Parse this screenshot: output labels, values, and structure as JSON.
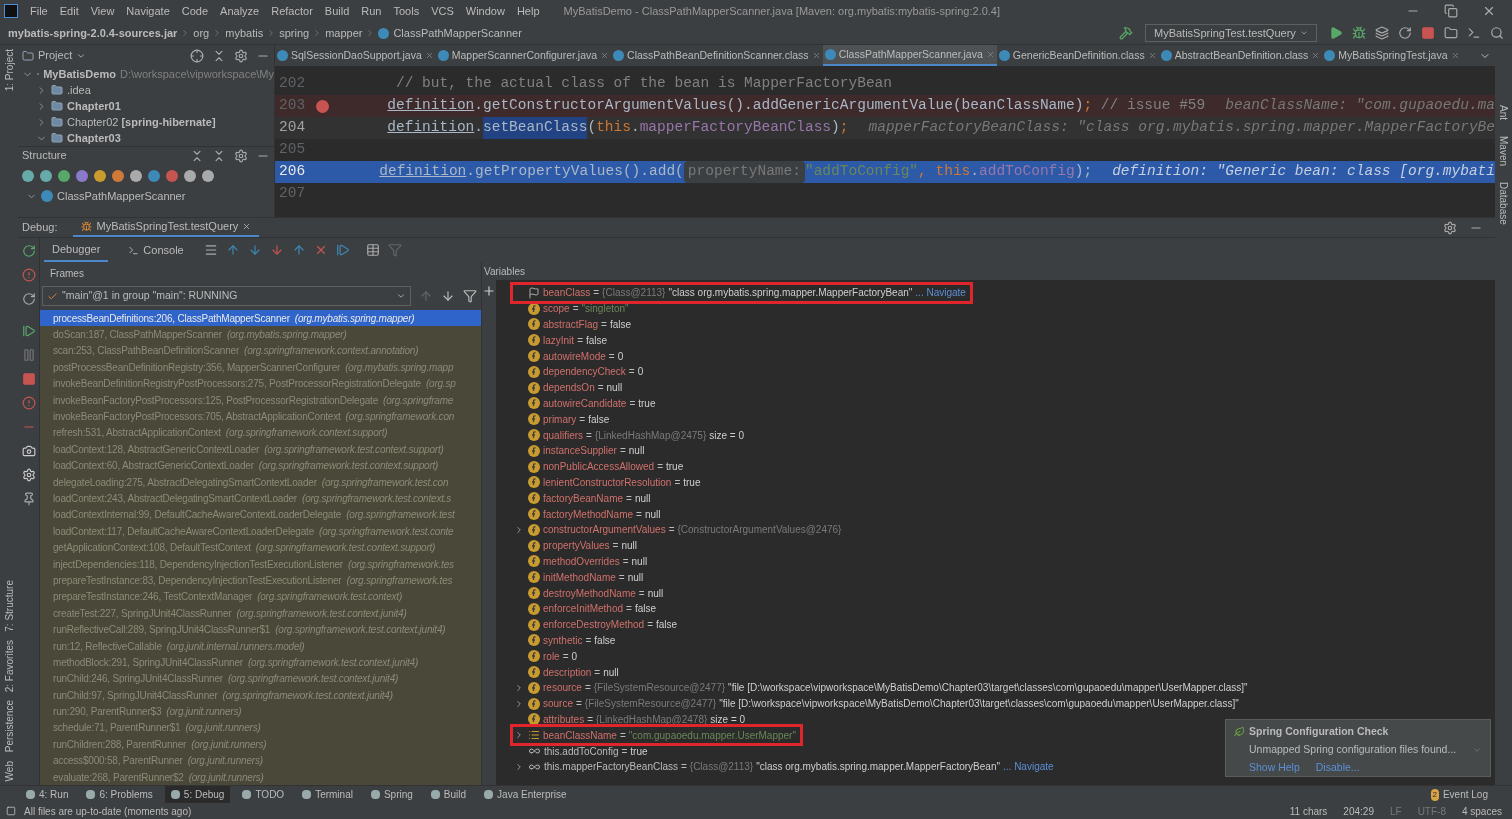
{
  "menu": [
    "File",
    "Edit",
    "View",
    "Navigate",
    "Code",
    "Analyze",
    "Refactor",
    "Build",
    "Run",
    "Tools",
    "VCS",
    "Window",
    "Help"
  ],
  "window": {
    "title": "MyBatisDemo - ClassPathMapperScanner.java [Maven: org.mybatis:mybatis-spring:2.0.4]"
  },
  "breadcrumb": [
    "mybatis-spring-2.0.4-sources.jar",
    "org",
    "mybatis",
    "spring",
    "mapper",
    "ClassPathMapperScanner"
  ],
  "run_config": "MyBatisSpringTest.testQuery",
  "left_strip": [
    "1: Project",
    "7: Structure",
    "2: Favorites",
    "Persistence",
    "Web"
  ],
  "right_strip": [
    "Ant",
    "Maven",
    "Database"
  ],
  "project": {
    "title": "Project",
    "tree": [
      {
        "label": "MyBatisDemo",
        "path": "D:\\workspace\\vipworkspace\\My",
        "bold": true,
        "expanded": true,
        "children": [
          {
            "label": ".idea",
            "bold": false,
            "expanded": false
          },
          {
            "label": "Chapter01",
            "bold": true,
            "expanded": false
          },
          {
            "label": "Chapter02 **[spring-hibernate]**",
            "bold": false,
            "expanded": false
          },
          {
            "label": "Chapter03",
            "bold": true,
            "expanded": true
          }
        ]
      }
    ]
  },
  "structure": {
    "title": "Structure",
    "root": "ClassPathMapperScanner"
  },
  "editor_tabs": [
    {
      "label": "SqlSessionDaoSupport.java",
      "selected": false
    },
    {
      "label": "MapperScannerConfigurer.java",
      "selected": false
    },
    {
      "label": "ClassPathBeanDefinitionScanner.class",
      "selected": false
    },
    {
      "label": "ClassPathMapperScanner.java",
      "selected": true
    },
    {
      "label": "GenericBeanDefinition.class",
      "selected": false
    },
    {
      "label": "AbstractBeanDefinition.class",
      "selected": false
    },
    {
      "label": "MyBatisSpringTest.java",
      "selected": false
    }
  ],
  "code": [
    {
      "number": "202",
      "kind": "plain",
      "segments": [
        {
          "text": "// but, the actual class of the bean is MapperFactoryBean",
          "kind": "comment"
        }
      ]
    },
    {
      "number": "203",
      "kind": "breakpoint",
      "segments": [
        {
          "text": "definition",
          "kind": "var"
        },
        {
          "text": ".getConstructorArgumentValues().addGenericArgumentValue(beanClassName)",
          "kind": "plain"
        },
        {
          "text": ";",
          "kind": "keyword"
        },
        {
          "text": " // issue #59",
          "kind": "comment"
        }
      ],
      "hint": "beanClassName: \"com.gupaoedu.ma"
    },
    {
      "number": "204",
      "kind": "caret",
      "segments": [
        {
          "text": "definition",
          "kind": "var"
        },
        {
          "text": ".",
          "kind": "plain"
        },
        {
          "text": "setBeanClass",
          "kind": "selection"
        },
        {
          "text": "(",
          "kind": "plain"
        },
        {
          "text": "this",
          "kind": "keyword"
        },
        {
          "text": ".",
          "kind": "plain"
        },
        {
          "text": "mapperFactoryBeanClass",
          "kind": "field"
        },
        {
          "text": ")",
          "kind": "plain"
        },
        {
          "text": ";",
          "kind": "keyword"
        }
      ],
      "hint": "mapperFactoryBeanClass: \"class org.mybatis.spring.mapper.MapperFactoryBe"
    },
    {
      "number": "205",
      "kind": "plain"
    },
    {
      "number": "206",
      "kind": "execution",
      "segments": [
        {
          "text": "definition",
          "kind": "var"
        },
        {
          "text": ".getPropertyValues().add(",
          "kind": "plain"
        },
        {
          "text": "propertyName:",
          "kind": "param"
        },
        {
          "text": "\"addToConfig\"",
          "kind": "string"
        },
        {
          "text": ", ",
          "kind": "keyword"
        },
        {
          "text": "this",
          "kind": "keyword"
        },
        {
          "text": ".",
          "kind": "plain"
        },
        {
          "text": "addToConfig",
          "kind": "field"
        },
        {
          "text": ");",
          "kind": "plain"
        }
      ],
      "hint": "definition: \"Generic bean: class [org.mybati"
    },
    {
      "number": "207",
      "kind": "plain"
    }
  ],
  "debug": {
    "label": "Debug:",
    "session": "MyBatisSpringTest.testQuery",
    "tabs": [
      {
        "label": "Debugger",
        "selected": true
      },
      {
        "label": "Console",
        "selected": false
      }
    ],
    "frames_title": "Frames",
    "thread": "\"main\"@1 in group \"main\": RUNNING",
    "frames": [
      {
        "method": "processBeanDefinitions:206, ClassPathMapperScanner",
        "package": "(org.mybatis.spring.mapper)",
        "selected": true
      },
      {
        "method": "doScan:187, ClassPathMapperScanner",
        "package": "(org.mybatis.spring.mapper)",
        "selected": false
      },
      {
        "method": "scan:253, ClassPathBeanDefinitionScanner",
        "package": "(org.springframework.context.annotation)",
        "selected": false
      },
      {
        "method": "postProcessBeanDefinitionRegistry:356, MapperScannerConfigurer",
        "package": "(org.mybatis.spring.mapp",
        "selected": false
      },
      {
        "method": "invokeBeanDefinitionRegistryPostProcessors:275, PostProcessorRegistrationDelegate",
        "package": "(org.sp",
        "selected": false
      },
      {
        "method": "invokeBeanFactoryPostProcessors:125, PostProcessorRegistrationDelegate",
        "package": "(org.springframe",
        "selected": false
      },
      {
        "method": "invokeBeanFactoryPostProcessors:705, AbstractApplicationContext",
        "package": "(org.springframework.con",
        "selected": false
      },
      {
        "method": "refresh:531, AbstractApplicationContext",
        "package": "(org.springframework.context.support)",
        "selected": false
      },
      {
        "method": "loadContext:128, AbstractGenericContextLoader",
        "package": "(org.springframework.test.context.support)",
        "selected": false
      },
      {
        "method": "loadContext:60, AbstractGenericContextLoader",
        "package": "(org.springframework.test.context.support)",
        "selected": false
      },
      {
        "method": "delegateLoading:275, AbstractDelegatingSmartContextLoader",
        "package": "(org.springframework.test.con",
        "selected": false
      },
      {
        "method": "loadContext:243, AbstractDelegatingSmartContextLoader",
        "package": "(org.springframework.test.context.s",
        "selected": false
      },
      {
        "method": "loadContextInternal:99, DefaultCacheAwareContextLoaderDelegate",
        "package": "(org.springframework.test",
        "selected": false
      },
      {
        "method": "loadContext:117, DefaultCacheAwareContextLoaderDelegate",
        "package": "(org.springframework.test.conte",
        "selected": false
      },
      {
        "method": "getApplicationContext:108, DefaultTestContext",
        "package": "(org.springframework.test.context.support)",
        "selected": false
      },
      {
        "method": "injectDependencies:118, DependencyInjectionTestExecutionListener",
        "package": "(org.springframework.tes",
        "selected": false
      },
      {
        "method": "prepareTestInstance:83, DependencyInjectionTestExecutionListener",
        "package": "(org.springframework.tes",
        "selected": false
      },
      {
        "method": "prepareTestInstance:246, TestContextManager",
        "package": "(org.springframework.test.context)",
        "selected": false
      },
      {
        "method": "createTest:227, SpringJUnit4ClassRunner",
        "package": "(org.springframework.test.context.junit4)",
        "selected": false
      },
      {
        "method": "runReflectiveCall:289, SpringJUnit4ClassRunner$1",
        "package": "(org.springframework.test.context.junit4)",
        "selected": false
      },
      {
        "method": "run:12, ReflectiveCallable",
        "package": "(org.junit.internal.runners.model)",
        "selected": false
      },
      {
        "method": "methodBlock:291, SpringJUnit4ClassRunner",
        "package": "(org.springframework.test.context.junit4)",
        "selected": false
      },
      {
        "method": "runChild:246, SpringJUnit4ClassRunner",
        "package": "(org.springframework.test.context.junit4)",
        "selected": false
      },
      {
        "method": "runChild:97, SpringJUnit4ClassRunner",
        "package": "(org.springframework.test.context.junit4)",
        "selected": false
      },
      {
        "method": "run:290, ParentRunner$3",
        "package": "(org.junit.runners)",
        "selected": false
      },
      {
        "method": "schedule:71, ParentRunner$1",
        "package": "(org.junit.runners)",
        "selected": false
      },
      {
        "method": "runChildren:288, ParentRunner",
        "package": "(org.junit.runners)",
        "selected": false
      },
      {
        "method": "access$000:58, ParentRunner",
        "package": "(org.junit.runners)",
        "selected": false
      },
      {
        "method": "evaluate:268, ParentRunner$2",
        "package": "(org.junit.runners)",
        "selected": false
      }
    ],
    "variables_title": "Variables",
    "variables": [
      {
        "kind": "flag",
        "name": "beanClass",
        "sign": "=",
        "type": "{Class@2113}",
        "value": "\"class org.mybatis.spring.mapper.MapperFactoryBean\"",
        "link": "... Navigate",
        "expandable": false,
        "highlighted": true
      },
      {
        "kind": "field",
        "name": "scope",
        "sign": "=",
        "value": "\"singleton\"",
        "string": true,
        "expandable": false,
        "highlighted": false
      },
      {
        "kind": "field",
        "name": "abstractFlag",
        "sign": "=",
        "value": "false",
        "expandable": false,
        "highlighted": false
      },
      {
        "kind": "field",
        "name": "lazyInit",
        "sign": "=",
        "value": "false",
        "expandable": false,
        "highlighted": false
      },
      {
        "kind": "field",
        "name": "autowireMode",
        "sign": "=",
        "value": "0",
        "expandable": false,
        "highlighted": false
      },
      {
        "kind": "field",
        "name": "dependencyCheck",
        "sign": "=",
        "value": "0",
        "expandable": false,
        "highlighted": false
      },
      {
        "kind": "field",
        "name": "dependsOn",
        "sign": "=",
        "value": "null",
        "expandable": false,
        "highlighted": false
      },
      {
        "kind": "field",
        "name": "autowireCandidate",
        "sign": "=",
        "value": "true",
        "expandable": false,
        "highlighted": false
      },
      {
        "kind": "field",
        "name": "primary",
        "sign": "=",
        "value": "false",
        "expandable": false,
        "highlighted": false
      },
      {
        "kind": "field",
        "name": "qualifiers",
        "sign": "=",
        "type": "{LinkedHashMap@2475}",
        "value": "size = 0",
        "expandable": false,
        "highlighted": false
      },
      {
        "kind": "field",
        "name": "instanceSupplier",
        "sign": "=",
        "value": "null",
        "expandable": false,
        "highlighted": false
      },
      {
        "kind": "field",
        "name": "nonPublicAccessAllowed",
        "sign": "=",
        "value": "true",
        "expandable": false,
        "highlighted": false
      },
      {
        "kind": "field",
        "name": "lenientConstructorResolution",
        "sign": "=",
        "value": "true",
        "expandable": false,
        "highlighted": false
      },
      {
        "kind": "field",
        "name": "factoryBeanName",
        "sign": "=",
        "value": "null",
        "expandable": false,
        "highlighted": false
      },
      {
        "kind": "field",
        "name": "factoryMethodName",
        "sign": "=",
        "value": "null",
        "expandable": false,
        "highlighted": false
      },
      {
        "kind": "field",
        "name": "constructorArgumentValues",
        "sign": "=",
        "type": "{ConstructorArgumentValues@2476}",
        "expandable": true,
        "highlighted": false
      },
      {
        "kind": "field",
        "name": "propertyValues",
        "sign": "=",
        "value": "null",
        "expandable": false,
        "highlighted": false
      },
      {
        "kind": "field",
        "name": "methodOverrides",
        "sign": "=",
        "value": "null",
        "expandable": false,
        "highlighted": false
      },
      {
        "kind": "field",
        "name": "initMethodName",
        "sign": "=",
        "value": "null",
        "expandable": false,
        "highlighted": false
      },
      {
        "kind": "field",
        "name": "destroyMethodName",
        "sign": "=",
        "value": "null",
        "expandable": false,
        "highlighted": false
      },
      {
        "kind": "field",
        "name": "enforceInitMethod",
        "sign": "=",
        "value": "false",
        "expandable": false,
        "highlighted": false
      },
      {
        "kind": "field",
        "name": "enforceDestroyMethod",
        "sign": "=",
        "value": "false",
        "expandable": false,
        "highlighted": false
      },
      {
        "kind": "field",
        "name": "synthetic",
        "sign": "=",
        "value": "false",
        "expandable": false,
        "highlighted": false
      },
      {
        "kind": "field",
        "name": "role",
        "sign": "=",
        "value": "0",
        "expandable": false,
        "highlighted": false
      },
      {
        "kind": "field",
        "name": "description",
        "sign": "=",
        "value": "null",
        "expandable": false,
        "highlighted": false
      },
      {
        "kind": "field",
        "name": "resource",
        "sign": "=",
        "type": "{FileSystemResource@2477}",
        "value": "\"file [D:\\workspace\\vipworkspace\\MyBatisDemo\\Chapter03\\target\\classes\\com\\gupaoedu\\mapper\\UserMapper.class]\"",
        "expandable": true,
        "highlighted": false
      },
      {
        "kind": "field",
        "name": "source",
        "sign": "=",
        "type": "{FileSystemResource@2477}",
        "value": "\"file [D:\\workspace\\vipworkspace\\MyBatisDemo\\Chapter03\\target\\classes\\com\\gupaoedu\\mapper\\UserMapper.class]\"",
        "expandable": true,
        "highlighted": false
      },
      {
        "kind": "field",
        "name": "attributes",
        "sign": "=",
        "type": "{LinkedHashMap@2478}",
        "value": "size = 0",
        "expandable": false,
        "highlighted": false
      },
      {
        "kind": "list",
        "name": "beanClassName",
        "sign": "=",
        "value": "\"com.gupaoedu.mapper.UserMapper\"",
        "string": true,
        "expandable": true,
        "highlighted": true
      },
      {
        "kind": "watch",
        "name": "this.addToConfig",
        "sign": "=",
        "value": "true",
        "expandable": false,
        "highlighted": false
      },
      {
        "kind": "watch",
        "name": "this.mapperFactoryBeanClass",
        "sign": "=",
        "type": "{Class@2113}",
        "value": "\"class org.mybatis.spring.mapper.MapperFactoryBean\"",
        "link": "... Navigate",
        "expandable": true,
        "highlighted": false
      }
    ]
  },
  "notification": {
    "title": "Spring Configuration Check",
    "message": "Unmapped Spring configuration files found...",
    "actions": [
      "Show Help",
      "Disable..."
    ]
  },
  "tool_tabs": [
    {
      "label": "4: Run",
      "selected": false
    },
    {
      "label": "6: Problems",
      "selected": false
    },
    {
      "label": "5: Debug",
      "selected": true
    },
    {
      "label": "TODO",
      "selected": false
    },
    {
      "label": "Terminal",
      "selected": false
    },
    {
      "label": "Spring",
      "selected": false
    },
    {
      "label": "Build",
      "selected": false
    },
    {
      "label": "Java Enterprise",
      "selected": false
    }
  ],
  "event_log": {
    "label": "Event Log",
    "count": "2"
  },
  "status_bar": {
    "message": "All files are up-to-date (moments ago)",
    "items": [
      "11 chars",
      "204:29",
      "LF",
      "UTF-8",
      "4 spaces"
    ]
  }
}
